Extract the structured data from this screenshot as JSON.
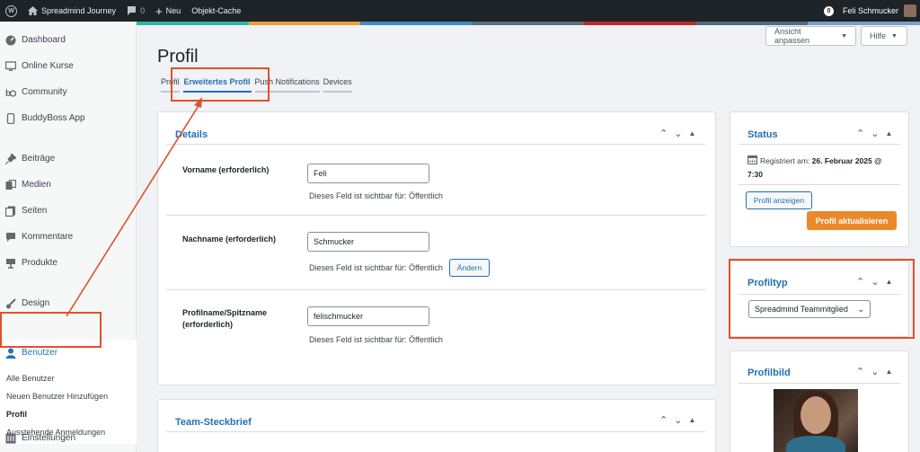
{
  "adminbar": {
    "site_name": "Spreadmind Journey",
    "comments_count": "0",
    "new_label": "Neu",
    "cache_label": "Objekt-Cache",
    "notif_count": "0",
    "user_name": "Feli Schmucker"
  },
  "colorstrip": [
    "#2fb6a5",
    "#e8a13a",
    "#3b8fc6",
    "#5b6f7d",
    "#c1272d",
    "#4f6b82",
    "#7aa0c4"
  ],
  "sidebar": {
    "items": [
      {
        "label": "Dashboard",
        "icon": "dashboard-icon"
      },
      {
        "label": "Online Kurse",
        "icon": "monitor-icon"
      },
      {
        "label": "Community",
        "icon": "community-icon"
      },
      {
        "label": "BuddyBoss App",
        "icon": "app-icon"
      },
      {
        "label": "Beiträge",
        "icon": "pin-icon"
      },
      {
        "label": "Medien",
        "icon": "media-icon"
      },
      {
        "label": "Seiten",
        "icon": "pages-icon"
      },
      {
        "label": "Kommentare",
        "icon": "comment-icon"
      },
      {
        "label": "Produkte",
        "icon": "product-icon"
      },
      {
        "label": "Design",
        "icon": "brush-icon"
      },
      {
        "label": "Benutzer",
        "icon": "user-icon"
      },
      {
        "label": "Einstellungen",
        "icon": "settings-icon"
      }
    ],
    "submenu": [
      "Alle Benutzer",
      "Neuen Benutzer Hinzufügen",
      "Profil",
      "Ausstehende Anmeldungen"
    ]
  },
  "header": {
    "page_title": "Profil",
    "screen_options": "Ansicht anpassen",
    "help": "Hilfe"
  },
  "tabs": [
    "Profil",
    "Erweitertes Profil",
    "Push Notifications",
    "Devices"
  ],
  "details": {
    "title": "Details",
    "fields": [
      {
        "label": "Vorname (erforderlich)",
        "value": "Feli",
        "visibility": "Dieses Feld ist sichtbar für: Öffentlich"
      },
      {
        "label": "Nachname (erforderlich)",
        "value": "Schmucker",
        "visibility": "Dieses Feld ist sichtbar für: Öffentlich",
        "change_button": "Ändern"
      },
      {
        "label": "Profilname/Spitzname (erforderlich)",
        "value": "felischmucker",
        "visibility": "Dieses Feld ist sichtbar für: Öffentlich"
      }
    ]
  },
  "team": {
    "title": "Team-Steckbrief"
  },
  "status": {
    "title": "Status",
    "registered_label": "Registriert am:",
    "registered_date": "26. Februar 2025 @",
    "registered_time": "7:30",
    "view_profile": "Profil anzeigen",
    "update_profile": "Profil aktualisieren"
  },
  "profiletype": {
    "title": "Profiltyp",
    "selected": "Spreadmind Teammitglied"
  },
  "profilepic": {
    "title": "Profilbild"
  }
}
